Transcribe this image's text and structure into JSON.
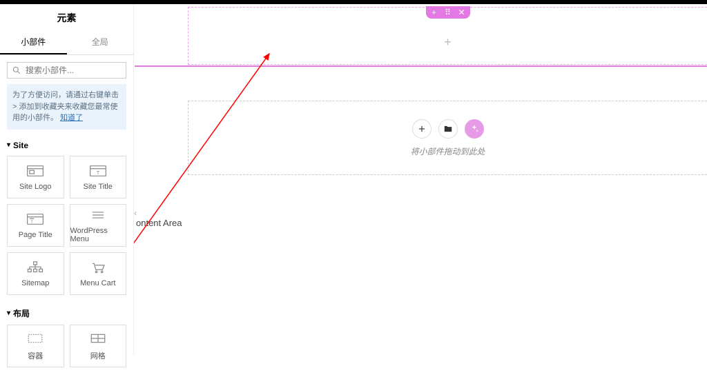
{
  "panel": {
    "title": "元素",
    "tabs": {
      "widgets": "小部件",
      "global": "全局"
    },
    "search_placeholder": "搜索小部件...",
    "tip_text": "为了方便访问，请通过右键单击 > 添加到收藏夹来收藏您最常使用的小部件。",
    "tip_link": "知道了"
  },
  "categories": {
    "site": {
      "title": "Site",
      "widgets": [
        {
          "label": "Site Logo"
        },
        {
          "label": "Site Title"
        },
        {
          "label": "Page Title"
        },
        {
          "label": "WordPress Menu"
        },
        {
          "label": "Sitemap"
        },
        {
          "label": "Menu Cart"
        }
      ]
    },
    "layout": {
      "title": "布局",
      "widgets": [
        {
          "label": "容器"
        },
        {
          "label": "网格"
        }
      ]
    }
  },
  "canvas": {
    "drop_hint": "将小部件拖动到此处",
    "content_area_label": "ontent Area"
  }
}
